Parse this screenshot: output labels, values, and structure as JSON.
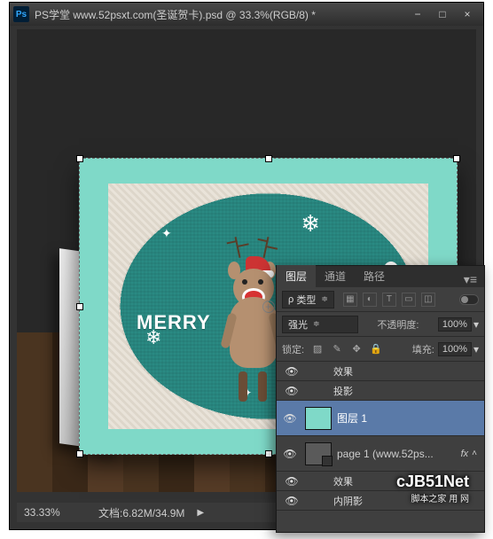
{
  "window": {
    "title": "PS学堂 www.52psxt.com(圣诞贺卡).psd @ 33.3%(RGB/8) *",
    "min": "−",
    "max": "□",
    "close": "×"
  },
  "canvas": {
    "merry": "MERRY"
  },
  "statusbar": {
    "zoom": "33.33%",
    "doc_label": "文档:",
    "doc_value": "6.82M/34.9M",
    "arrow": "▶"
  },
  "panel": {
    "tabs": {
      "layers": "图层",
      "channels": "通道",
      "paths": "路径"
    },
    "kind": "类型",
    "blend": "强光",
    "opacity_label": "不透明度:",
    "opacity_value": "100%",
    "lock_label": "锁定:",
    "fill_label": "填充:",
    "fill_value": "100%",
    "effects": "效果",
    "drop_shadow": "投影",
    "inner_shadow": "内阴影",
    "layer1": "图层 1",
    "page1": "page 1 (www.52ps...",
    "fx": "fx"
  },
  "watermark": {
    "main": "cJB51Net",
    "sub": "脚本之家  用 网"
  }
}
